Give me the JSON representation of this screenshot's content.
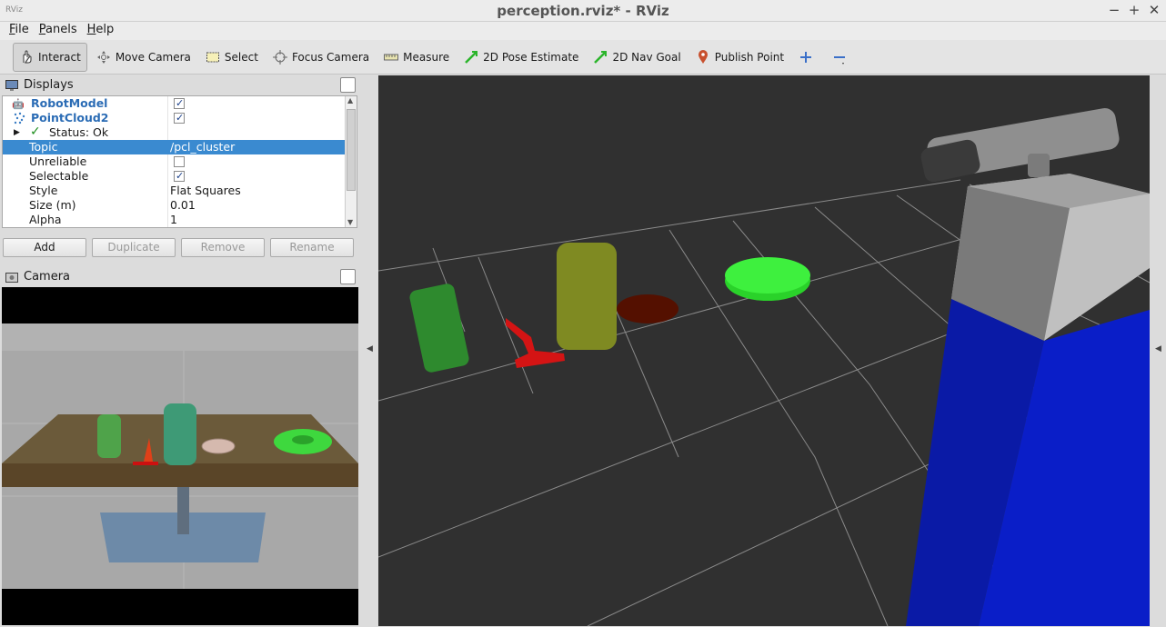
{
  "window": {
    "title": "perception.rviz* - RViz",
    "logo_text": "RViz"
  },
  "menu": [
    "File",
    "Panels",
    "Help"
  ],
  "toolbar": {
    "tools": [
      {
        "label": "Interact",
        "icon": "hand-icon",
        "active": true
      },
      {
        "label": "Move Camera",
        "icon": "move-camera-icon"
      },
      {
        "label": "Select",
        "icon": "select-icon"
      },
      {
        "label": "Focus Camera",
        "icon": "focus-camera-icon"
      },
      {
        "label": "Measure",
        "icon": "measure-icon"
      },
      {
        "label": "2D Pose Estimate",
        "icon": "pose-estimate-icon"
      },
      {
        "label": "2D Nav Goal",
        "icon": "nav-goal-icon"
      },
      {
        "label": "Publish Point",
        "icon": "publish-point-icon"
      }
    ]
  },
  "displays": {
    "title": "Displays",
    "rows": [
      {
        "label": "RobotModel",
        "checked": true
      },
      {
        "label": "PointCloud2",
        "checked": true
      },
      {
        "label": "Status: Ok"
      },
      {
        "label": "Topic",
        "value": "/pcl_cluster"
      },
      {
        "label": "Unreliable",
        "checked": false
      },
      {
        "label": "Selectable",
        "checked": true
      },
      {
        "label": "Style",
        "value": "Flat Squares"
      },
      {
        "label": "Size (m)",
        "value": "0.01"
      },
      {
        "label": "Alpha",
        "value": "1"
      }
    ],
    "buttons": {
      "add": "Add",
      "duplicate": "Duplicate",
      "remove": "Remove",
      "rename": "Rename"
    }
  },
  "camera": {
    "title": "Camera"
  },
  "colors": {
    "selection": "#3a8ad0",
    "grid_bg": "#303030",
    "robot_blue": "#0a1aa6"
  }
}
